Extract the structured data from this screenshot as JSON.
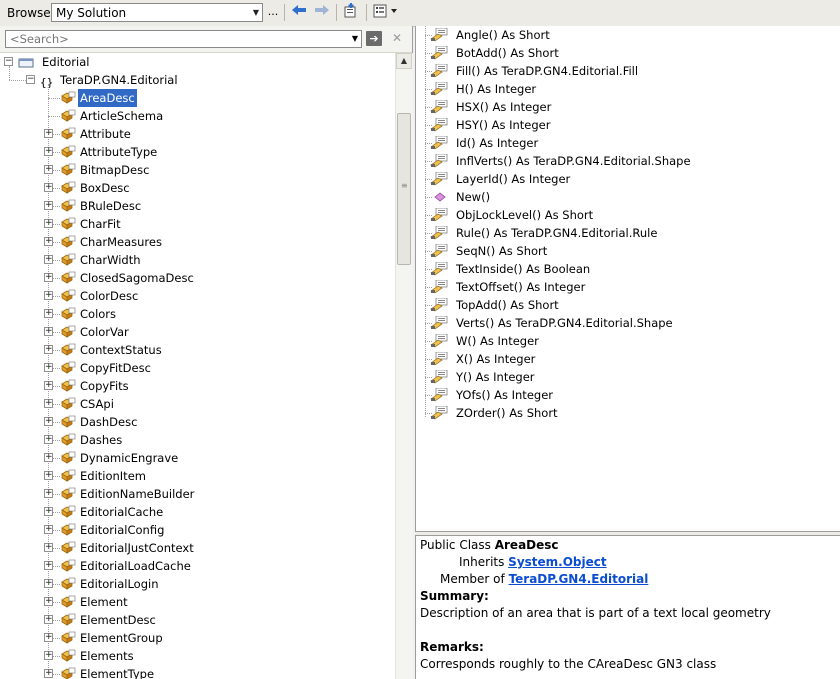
{
  "toolbar": {
    "browse_label": "Browse:",
    "solution_value": "My Solution",
    "ellipsis": "...",
    "icons": [
      "back-arrow-icon",
      "forward-arrow-icon",
      "add-reference-icon",
      "settings-icon"
    ]
  },
  "search": {
    "placeholder": "<Search>"
  },
  "tree": {
    "root": "Editorial",
    "namespace": "TeraDP.GN4.Editorial",
    "selected": "AreaDesc",
    "items": [
      "AreaDesc",
      "ArticleSchema",
      "Attribute",
      "AttributeType",
      "BitmapDesc",
      "BoxDesc",
      "BRuleDesc",
      "CharFit",
      "CharMeasures",
      "CharWidth",
      "ClosedSagomaDesc",
      "ColorDesc",
      "Colors",
      "ColorVar",
      "ContextStatus",
      "CopyFitDesc",
      "CopyFits",
      "CSApi",
      "DashDesc",
      "Dashes",
      "DynamicEngrave",
      "EditionItem",
      "EditionNameBuilder",
      "EditorialCache",
      "EditorialConfig",
      "EditorialJustContext",
      "EditorialLoadCache",
      "EditorialLogin",
      "Element",
      "ElementDesc",
      "ElementGroup",
      "Elements",
      "ElementType"
    ]
  },
  "members": [
    "Angle() As Short",
    "BotAdd() As Short",
    "Fill() As TeraDP.GN4.Editorial.Fill",
    "H() As Integer",
    "HSX() As Integer",
    "HSY() As Integer",
    "Id() As Integer",
    "InflVerts() As TeraDP.GN4.Editorial.Shape",
    "LayerId() As Integer",
    "New()",
    "ObjLockLevel() As Short",
    "Rule() As TeraDP.GN4.Editorial.Rule",
    "SeqN() As Short",
    "TextInside() As Boolean",
    "TextOffset() As Integer",
    "TopAdd() As Short",
    "Verts() As TeraDP.GN4.Editorial.Shape",
    "W() As Integer",
    "X() As Integer",
    "Y() As Integer",
    "YOfs() As Integer",
    "ZOrder() As Short"
  ],
  "description": {
    "class_prefix": "Public Class ",
    "class_name": "AreaDesc",
    "inherits_label": "Inherits ",
    "inherits_a": "System",
    "inherits_dot": ".",
    "inherits_b": "Object",
    "member_of_label": "Member of ",
    "member_a": "TeraDP",
    "member_dot1": ".",
    "member_b": "GN4",
    "member_dot2": ".",
    "member_c": "Editorial",
    "summary_label": "Summary:",
    "summary_text": "Description of an area that is part of a text local geometry",
    "remarks_label": "Remarks:",
    "remarks_text": "Corresponds roughly to the CAreaDesc GN3 class"
  }
}
